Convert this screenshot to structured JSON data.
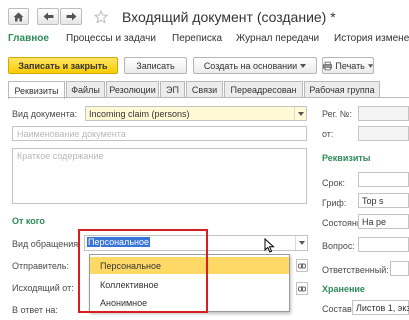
{
  "window": {
    "title": "Входящий документ (создание) *",
    "star_icon": "star-icon"
  },
  "menu": {
    "items": [
      "Главное",
      "Процессы и задачи",
      "Переписка",
      "Журнал передачи",
      "История изменен"
    ]
  },
  "toolbar": {
    "save_close": "Записать и закрыть",
    "save": "Записать",
    "create_based": "Создать на основании",
    "print": "Печать"
  },
  "tabs": [
    "Реквизиты",
    "Файлы",
    "Резолюции",
    "ЭП",
    "Связи",
    "Переадресован",
    "Рабочая группа"
  ],
  "form": {
    "doc_type_label": "Вид документа:",
    "doc_type_value": "Incoming claim (persons)",
    "doc_name_placeholder": "Наименование документа",
    "summary_placeholder": "Краткое содержание",
    "from_section": "От кого",
    "appeal_type_label": "Вид обращения:",
    "appeal_type_value": "Персональное",
    "sender_label": "Отправитель:",
    "outgoing_label": "Исходящий от:",
    "reply_label": "В ответ на:",
    "dropdown_options": [
      "Персональное",
      "Коллективное",
      "Анонимное"
    ],
    "selected_index": 0
  },
  "right_panel": {
    "reg_no_label": "Рег. №:",
    "from_label": "от:",
    "requisites_section": "Реквизиты",
    "term_label": "Срок:",
    "grif_label": "Гриф:",
    "grif_value": "Top s",
    "status_label": "Состояние:",
    "status_value": "На ре",
    "question_label": "Вопрос:",
    "responsible_label": "Ответственный:",
    "storage_section": "Хранение",
    "composition_label": "Состав:",
    "composition_value": "Листов 1, экз"
  },
  "colors": {
    "accent_green": "#2e8b57",
    "primary_yellow": "#f8cc00",
    "highlight_red": "#d42020"
  }
}
